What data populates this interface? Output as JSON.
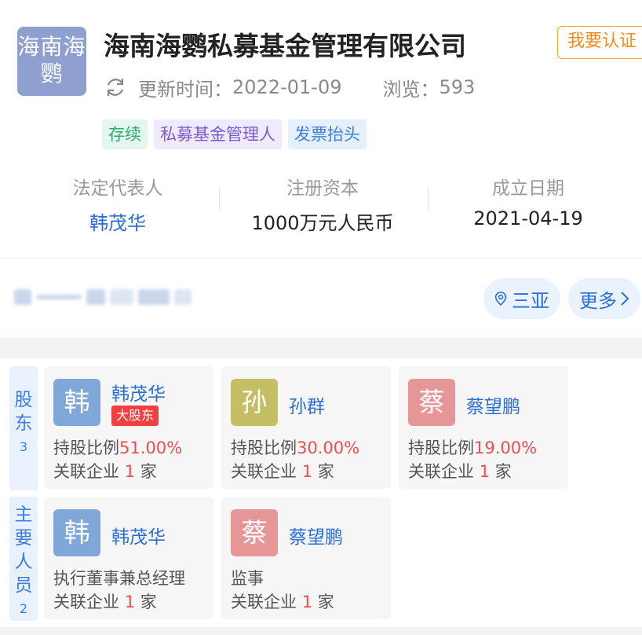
{
  "company": {
    "logo_text": "海南海鹦",
    "name": "海南海鹦私募基金管理有限公司",
    "certify_label": "我要认证",
    "updated_label": "更新时间：",
    "updated_value": "2022-01-09",
    "views_label": "浏览：",
    "views_value": "593",
    "tags": [
      "存续",
      "私募基金管理人",
      "发票抬头"
    ]
  },
  "summary": {
    "legal_rep_label": "法定代表人",
    "legal_rep_value": "韩茂华",
    "capital_label": "注册资本",
    "capital_value": "1000万元人民币",
    "founded_label": "成立日期",
    "founded_value": "2021-04-19"
  },
  "location": {
    "city": "三亚",
    "more_label": "更多"
  },
  "shareholders": {
    "label_chars": [
      "股",
      "东"
    ],
    "count": "3",
    "items": [
      {
        "avatar": "韩",
        "name": "韩茂华",
        "badge": "大股东",
        "ratio_label": "持股比例",
        "ratio": "51.00%",
        "related_prefix": "关联企业",
        "related_count": "1",
        "related_suffix": "家",
        "avatar_color": "#7fa8d9"
      },
      {
        "avatar": "孙",
        "name": "孙群",
        "ratio_label": "持股比例",
        "ratio": "30.00%",
        "related_prefix": "关联企业",
        "related_count": "1",
        "related_suffix": "家",
        "avatar_color": "#c4be64"
      },
      {
        "avatar": "蔡",
        "name": "蔡望鹏",
        "ratio_label": "持股比例",
        "ratio": "19.00%",
        "related_prefix": "关联企业",
        "related_count": "1",
        "related_suffix": "家",
        "avatar_color": "#e69696"
      }
    ]
  },
  "key_people": {
    "label_chars": [
      "主",
      "要",
      "人",
      "员"
    ],
    "count": "2",
    "items": [
      {
        "avatar": "韩",
        "name": "韩茂华",
        "role": "执行董事兼总经理",
        "related_prefix": "关联企业",
        "related_count": "1",
        "related_suffix": "家",
        "avatar_color": "#7fa8d9"
      },
      {
        "avatar": "蔡",
        "name": "蔡望鹏",
        "role": "监事",
        "related_prefix": "关联企业",
        "related_count": "1",
        "related_suffix": "家",
        "avatar_color": "#e69696"
      }
    ]
  }
}
